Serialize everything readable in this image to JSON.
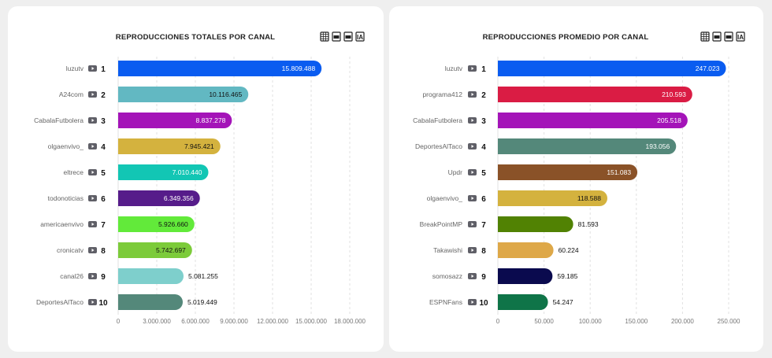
{
  "chart_data": [
    {
      "type": "bar",
      "orientation": "horizontal",
      "title": "REPRODUCCIONES TOTALES POR CANAL",
      "toolbar_icons": [
        "table-icon",
        "csv-icon",
        "xls-icon",
        "ia-icon"
      ],
      "toolbar_labels": {
        "ia": "IA"
      },
      "categories": [
        "luzutv",
        "A24com",
        "CabalaFutbolera",
        "olgaenvivo_",
        "eltrece",
        "todonoticias",
        "americaenvivo",
        "cronicatv",
        "canal26",
        "DeportesAlTaco"
      ],
      "ranks": [
        "1",
        "2",
        "3",
        "4",
        "5",
        "6",
        "7",
        "8",
        "9",
        "10"
      ],
      "values": [
        15809488,
        10116465,
        8837278,
        7945421,
        7010440,
        6349356,
        5926660,
        5742697,
        5081255,
        5019449
      ],
      "value_labels": [
        "15.809.488",
        "10.116.465",
        "8.837.278",
        "7.945.421",
        "7.010.440",
        "6.349.356",
        "5.926.660",
        "5.742.697",
        "5.081.255",
        "5.019.449"
      ],
      "colors": [
        "#0a5cf0",
        "#62b8c2",
        "#a414b8",
        "#d4b23e",
        "#12c6b4",
        "#561c8a",
        "#62ea3a",
        "#7ccb3a",
        "#7ecfcc",
        "#54887a"
      ],
      "label_colors": [
        "#ffffff",
        "#111111",
        "#ffffff",
        "#111111",
        "#ffffff",
        "#ffffff",
        "#111111",
        "#111111",
        "#111111",
        "#111111"
      ],
      "label_inside": [
        true,
        true,
        true,
        true,
        true,
        true,
        true,
        true,
        false,
        false
      ],
      "xlim": [
        0,
        18000000
      ],
      "xticks": [
        0,
        3000000,
        6000000,
        9000000,
        12000000,
        15000000,
        18000000
      ],
      "xtick_labels": [
        "0",
        "3.000.000",
        "6.000.000",
        "9.000.000",
        "12.000.000",
        "15.000.000",
        "18.000.000"
      ],
      "grid": true,
      "category_icon": "youtube-icon"
    },
    {
      "type": "bar",
      "orientation": "horizontal",
      "title": "REPRODUCCIONES PROMEDIO POR CANAL",
      "toolbar_icons": [
        "table-icon",
        "csv-icon",
        "xls-icon",
        "ia-icon"
      ],
      "toolbar_labels": {
        "ia": "IA"
      },
      "categories": [
        "luzutv",
        "programa412",
        "CabalaFutbolera",
        "DeportesAlTaco",
        "Updr",
        "olgaenvivo_",
        "BreakPointMP",
        "Takawishi",
        "somosazz",
        "ESPNFans"
      ],
      "ranks": [
        "1",
        "2",
        "3",
        "4",
        "5",
        "6",
        "7",
        "8",
        "9",
        "10"
      ],
      "values": [
        247023,
        210593,
        205518,
        193056,
        151083,
        118588,
        81593,
        60224,
        59185,
        54247
      ],
      "value_labels": [
        "247.023",
        "210.593",
        "205.518",
        "193.056",
        "151.083",
        "118.588",
        "81.593",
        "60.224",
        "59.185",
        "54.247"
      ],
      "colors": [
        "#0a5cf0",
        "#da1c44",
        "#a414b8",
        "#54887a",
        "#8a5228",
        "#d4b23e",
        "#518203",
        "#dea848",
        "#0a0a4e",
        "#0f7448"
      ],
      "label_colors": [
        "#ffffff",
        "#ffffff",
        "#ffffff",
        "#ffffff",
        "#ffffff",
        "#111111",
        "#111111",
        "#111111",
        "#111111",
        "#111111"
      ],
      "label_inside": [
        true,
        true,
        true,
        true,
        true,
        true,
        false,
        false,
        false,
        false
      ],
      "xlim": [
        0,
        250000
      ],
      "xticks": [
        0,
        50000,
        100000,
        150000,
        200000,
        250000
      ],
      "xtick_labels": [
        "0",
        "50.000",
        "100.000",
        "150.000",
        "200.000",
        "250.000"
      ],
      "grid": true,
      "category_icon": "youtube-icon"
    }
  ]
}
